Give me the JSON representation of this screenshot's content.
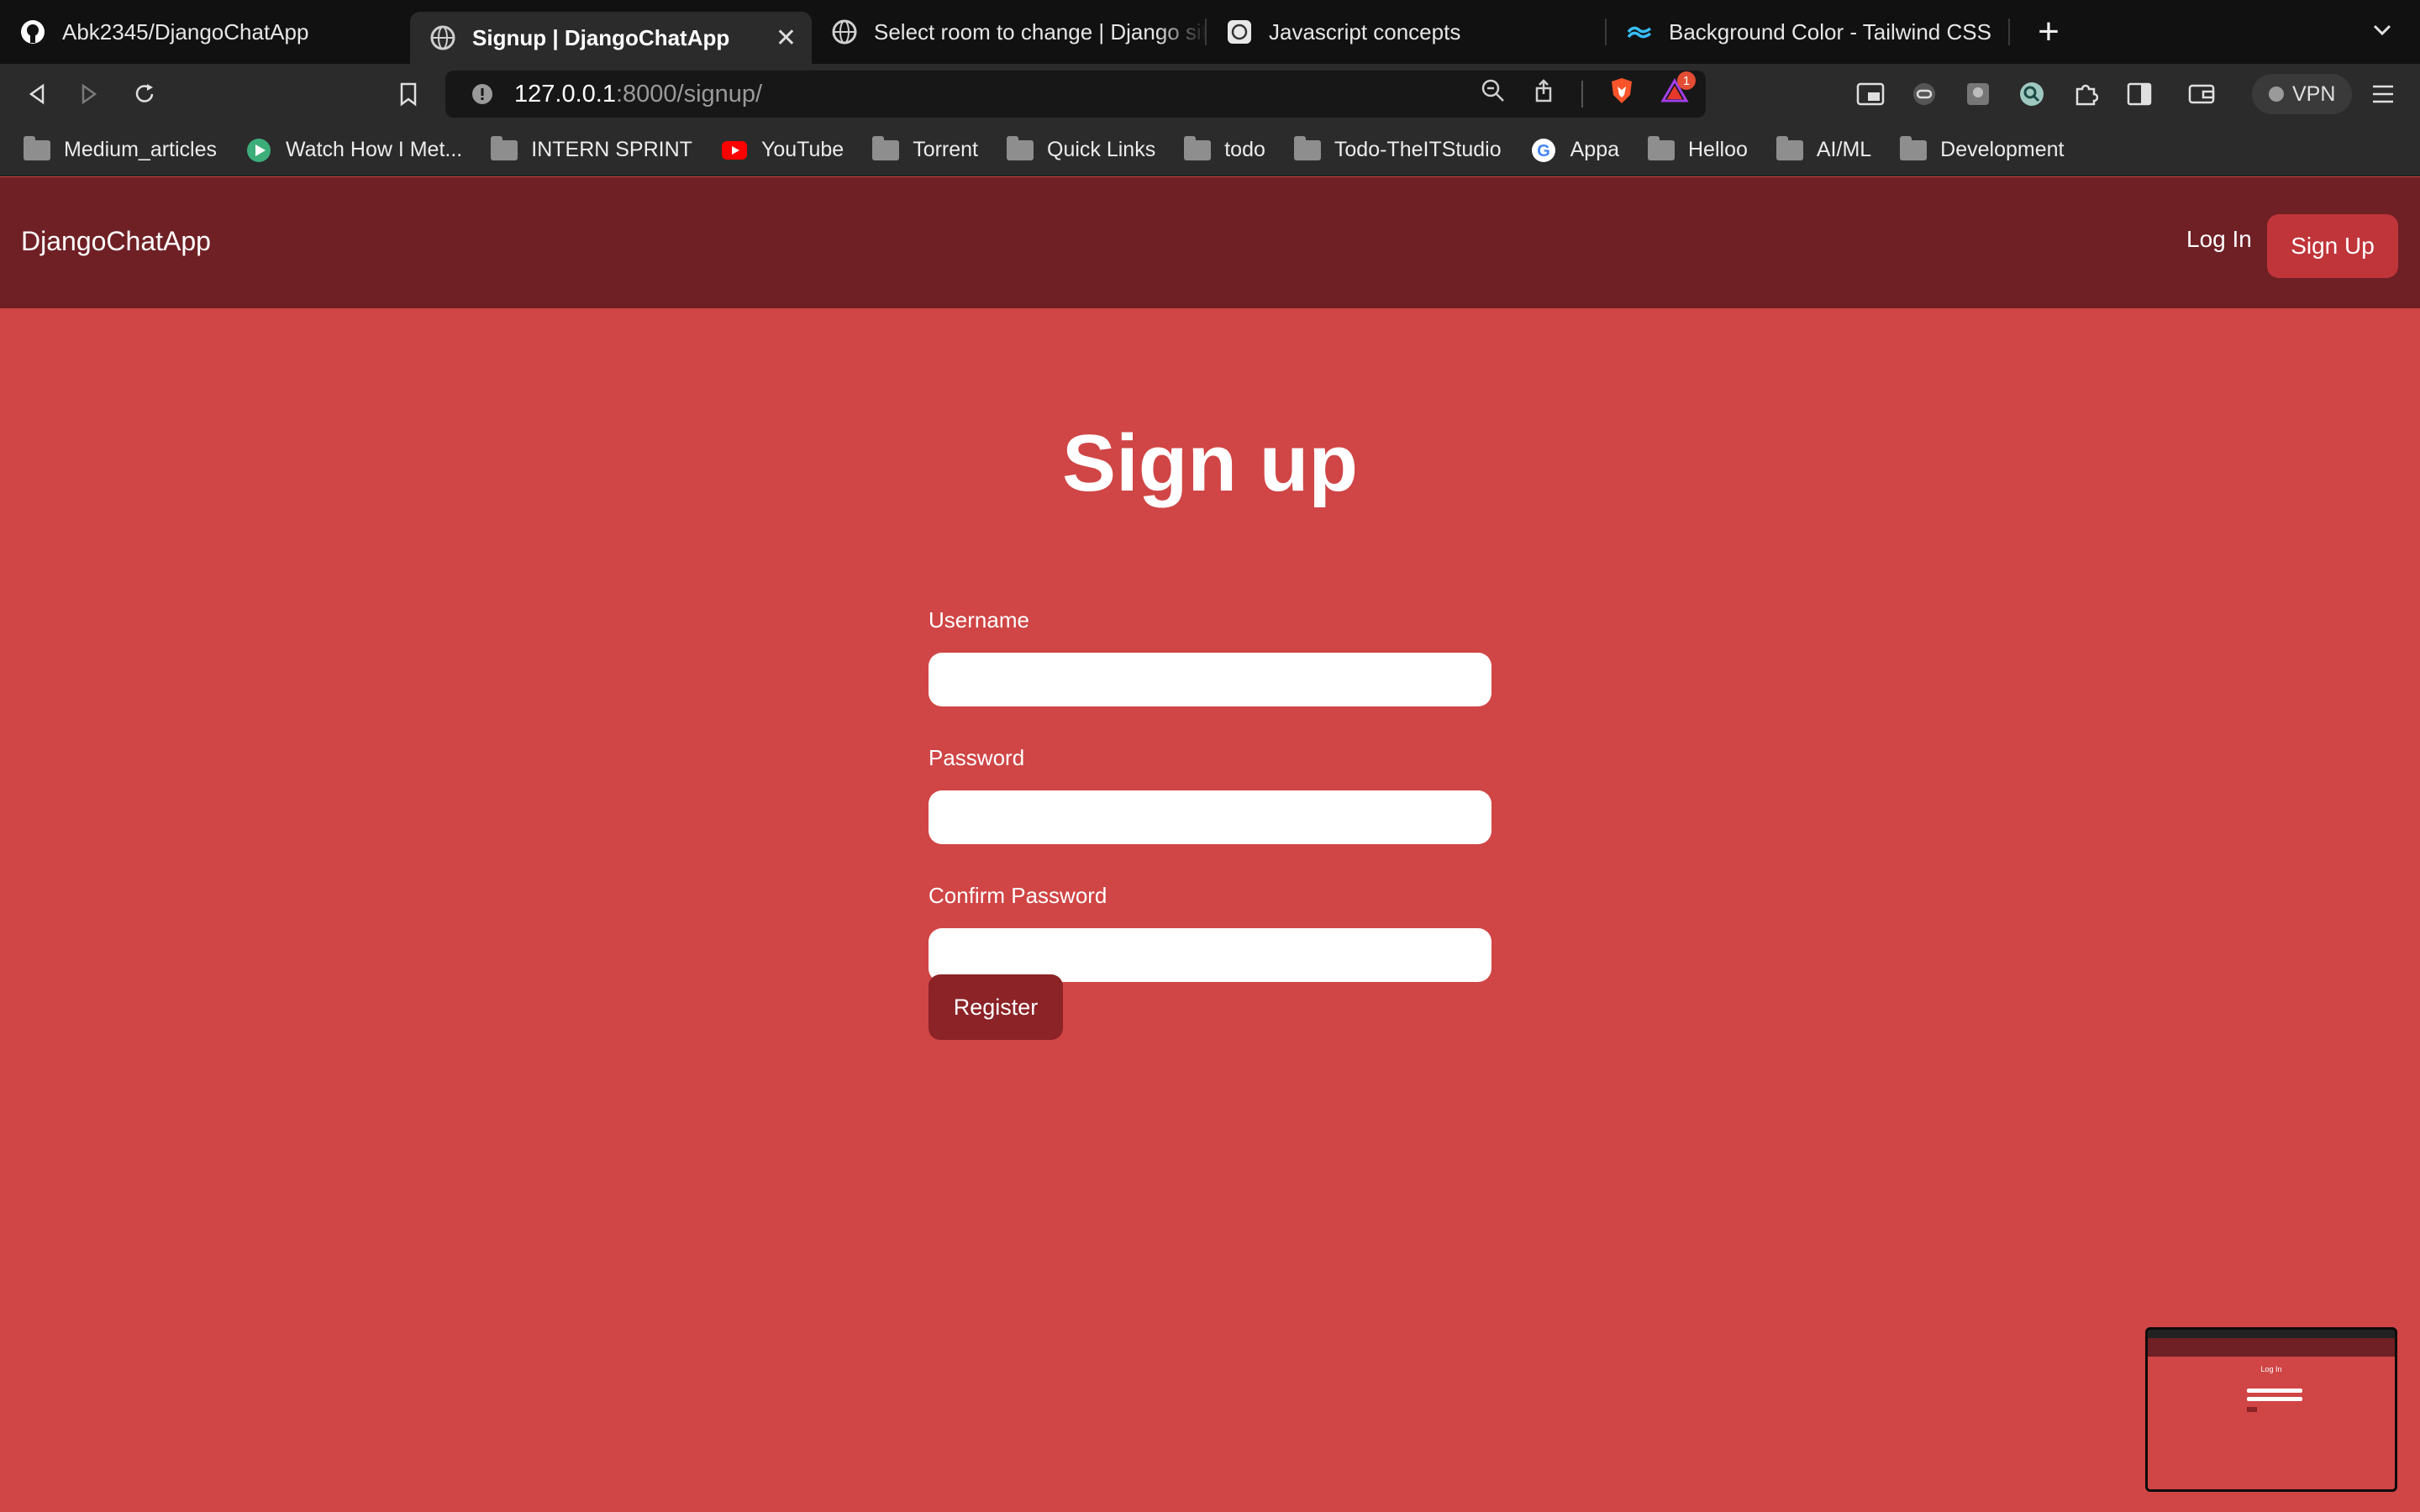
{
  "browser": {
    "tabs": [
      {
        "title": "Abk2345/DjangoChatApp",
        "icon": "github-icon",
        "active": false
      },
      {
        "title": "Signup | DjangoChatApp",
        "icon": "globe-icon",
        "active": true
      },
      {
        "title": "Select room to change | Django site",
        "icon": "globe-icon",
        "active": false
      },
      {
        "title": "Javascript concepts",
        "icon": "chatgpt-icon",
        "active": false
      },
      {
        "title": "Background Color - Tailwind CSS",
        "icon": "tailwind-icon",
        "active": false
      }
    ],
    "url_host": "127.0.0.1",
    "url_rest": ":8000/signup/",
    "brave_badge": "1",
    "vpn_label": "VPN",
    "bookmarks": [
      {
        "label": "Medium_articles",
        "icon": "folder-icon"
      },
      {
        "label": "Watch How I Met...",
        "icon": "play-icon"
      },
      {
        "label": "INTERN SPRINT",
        "icon": "folder-icon"
      },
      {
        "label": "YouTube",
        "icon": "youtube-icon"
      },
      {
        "label": "Torrent",
        "icon": "folder-icon"
      },
      {
        "label": "Quick Links",
        "icon": "folder-icon"
      },
      {
        "label": "todo",
        "icon": "folder-icon"
      },
      {
        "label": "Todo-TheITStudio",
        "icon": "folder-icon"
      },
      {
        "label": "Appa",
        "icon": "google-icon"
      },
      {
        "label": "Helloo",
        "icon": "folder-icon"
      },
      {
        "label": "AI/ML",
        "icon": "folder-icon"
      },
      {
        "label": "Development",
        "icon": "folder-icon"
      }
    ]
  },
  "app": {
    "brand": "DjangoChatApp",
    "nav_login": "Log In",
    "nav_signup": "Sign Up",
    "page_title": "Sign up",
    "fields": [
      {
        "label": "Username",
        "value": ""
      },
      {
        "label": "Password",
        "value": ""
      },
      {
        "label": "Confirm Password",
        "value": ""
      }
    ],
    "register_label": "Register"
  },
  "pip": {
    "title": "Log In"
  },
  "colors": {
    "page_bg": "#d04545",
    "nav_bg": "#6f2025",
    "nav_button": "#c0353a",
    "register_button": "#8b2327"
  }
}
